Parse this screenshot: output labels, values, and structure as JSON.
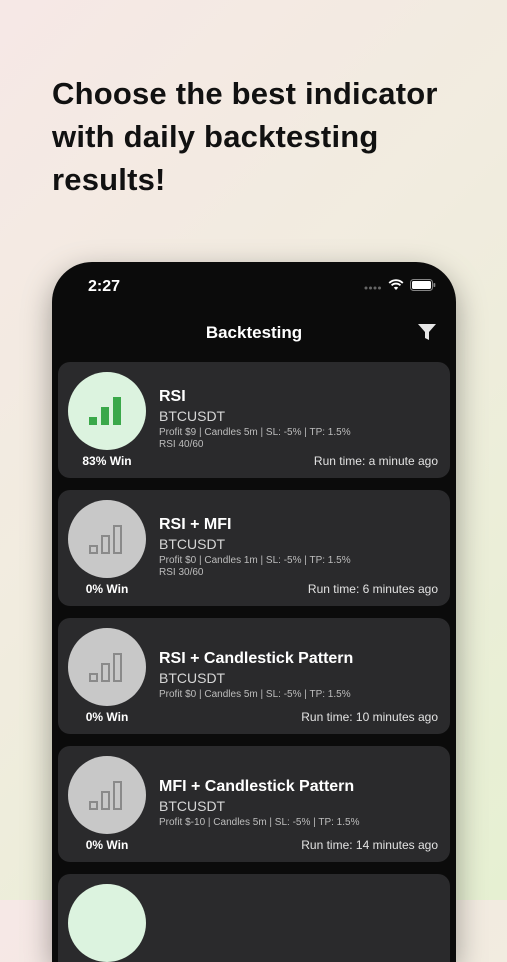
{
  "headline": "Choose the best indicator with daily backtesting results!",
  "status": {
    "time": "2:27"
  },
  "nav": {
    "title": "Backtesting"
  },
  "colors": {
    "win_bar": "#3aa84a",
    "lose_bar": "#8a8a8a",
    "win_bg": "#dcf3df",
    "lose_bg": "#c8c8c8"
  },
  "cards": [
    {
      "name": "RSI",
      "pair": "BTCUSDT",
      "details": "Profit $9 | Candles 5m | SL: -5% | TP: 1.5%",
      "details2": "RSI 40/60",
      "win": "83% Win",
      "runtime": "Run time: a minute ago",
      "icon": "bar-chart-icon-green"
    },
    {
      "name": "RSI + MFI",
      "pair": "BTCUSDT",
      "details": "Profit $0 | Candles 1m | SL: -5% | TP: 1.5%",
      "details2": "RSI 30/60",
      "win": "0% Win",
      "runtime": "Run time: 6 minutes ago",
      "icon": "bar-chart-icon-gray"
    },
    {
      "name": "RSI + Candlestick Pattern",
      "pair": "BTCUSDT",
      "details": "Profit $0 | Candles 5m | SL: -5% | TP: 1.5%",
      "details2": "",
      "win": "0% Win",
      "runtime": "Run time: 10 minutes ago",
      "icon": "bar-chart-icon-gray"
    },
    {
      "name": "MFI + Candlestick Pattern",
      "pair": "BTCUSDT",
      "details": "Profit $-10 | Candles 5m | SL: -5% | TP: 1.5%",
      "details2": "",
      "win": "0% Win",
      "runtime": "Run time: 14 minutes ago",
      "icon": "bar-chart-icon-gray"
    }
  ]
}
